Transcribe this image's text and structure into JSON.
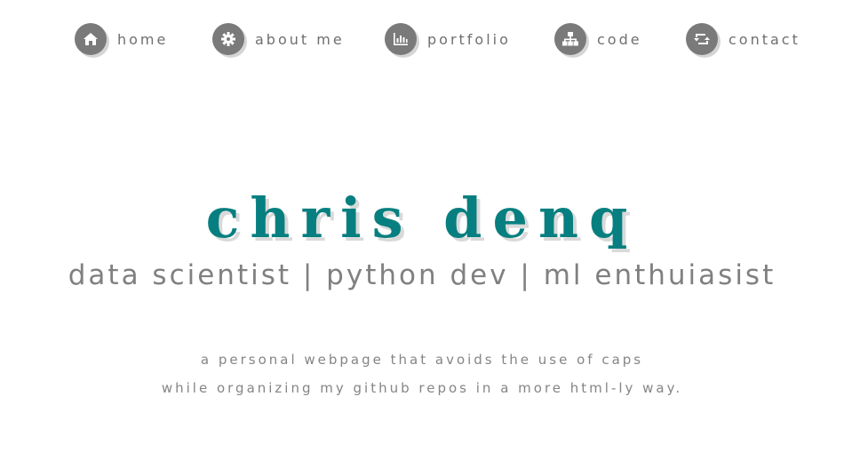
{
  "nav": {
    "items": [
      {
        "label": "home",
        "icon": "home-icon"
      },
      {
        "label": "about me",
        "icon": "gear-icon"
      },
      {
        "label": "portfolio",
        "icon": "bar-chart-icon"
      },
      {
        "label": "code",
        "icon": "sitemap-icon"
      },
      {
        "label": "contact",
        "icon": "retweet-icon"
      }
    ]
  },
  "hero": {
    "name": "chris denq",
    "subtitle": "data scientist | python dev | ml enthuiasist"
  },
  "tagline": {
    "line1": "a personal webpage that avoids the use of caps",
    "line2": "while organizing my github repos in a more html-ly way."
  },
  "colors": {
    "accent": "#077f80",
    "icon_bg": "#7a7a7a",
    "text": "#808080"
  }
}
